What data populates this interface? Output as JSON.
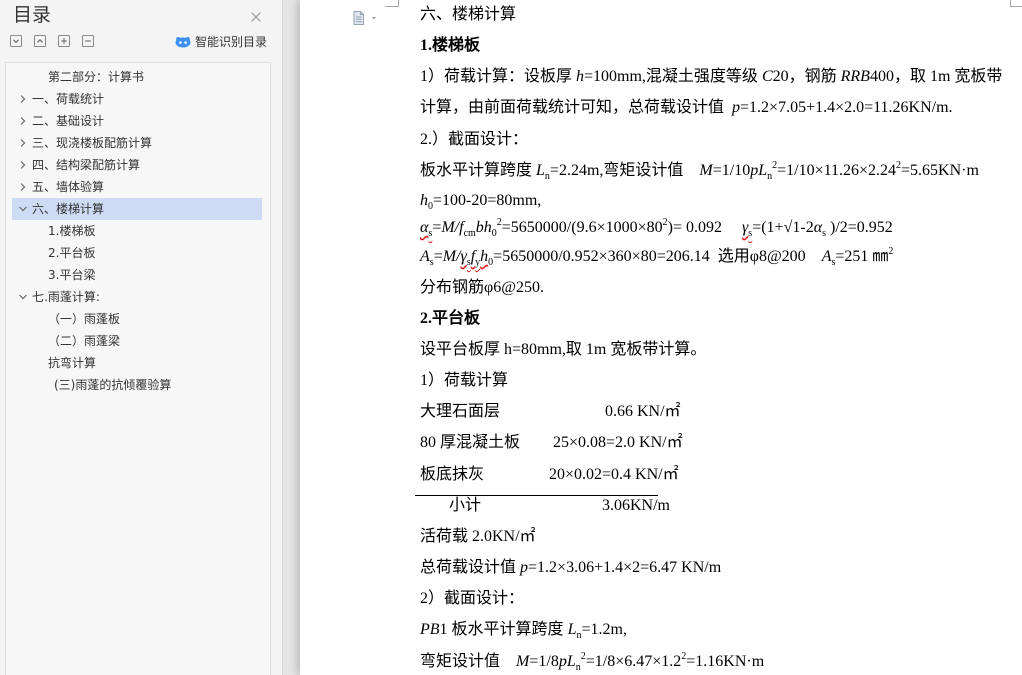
{
  "theme": {
    "selected_row": "#cddcf4",
    "accent": "#3a8ff5",
    "spellcheck_underline": "#e02020"
  },
  "sidebar": {
    "title": "目录",
    "close_icon": "close-icon",
    "tools": [
      "expand-all-icon",
      "collapse-all-icon",
      "add-heading-icon",
      "remove-heading-icon"
    ],
    "smart_toc": {
      "label": "智能识别目录",
      "icon": "smart-recognize-icon"
    },
    "items": [
      {
        "label": "第二部分：计算书",
        "level": 2,
        "icon": "",
        "selected": false
      },
      {
        "label": "一、荷载统计",
        "level": 1,
        "icon": "chevron-right-icon",
        "selected": false
      },
      {
        "label": "二、基础设计",
        "level": 1,
        "icon": "chevron-right-icon",
        "selected": false
      },
      {
        "label": "三、现浇楼板配筋计算",
        "level": 1,
        "icon": "chevron-right-icon",
        "selected": false
      },
      {
        "label": "四、结构梁配筋计算",
        "level": 1,
        "icon": "chevron-right-icon",
        "selected": false
      },
      {
        "label": "五、墙体验算",
        "level": 1,
        "icon": "chevron-right-icon",
        "selected": false
      },
      {
        "label": "六、楼梯计算",
        "level": 1,
        "icon": "chevron-down-icon",
        "selected": true
      },
      {
        "label": "1.楼梯板",
        "level": 2,
        "icon": "",
        "selected": false
      },
      {
        "label": "2.平台板",
        "level": 2,
        "icon": "",
        "selected": false
      },
      {
        "label": "3.平台梁",
        "level": 2,
        "icon": "",
        "selected": false
      },
      {
        "label": "七.雨蓬计算:",
        "level": 1,
        "icon": "chevron-down-icon",
        "selected": false
      },
      {
        "label": "（一）雨蓬板",
        "level": 2,
        "icon": "",
        "selected": false
      },
      {
        "label": "（二）雨蓬梁",
        "level": 2,
        "icon": "",
        "selected": false
      },
      {
        "label": "抗弯计算",
        "level": 2,
        "icon": "",
        "selected": false
      },
      {
        "label": "(三)雨蓬的抗倾覆验算",
        "level": 2,
        "icon": "",
        "selected": false
      }
    ]
  },
  "doc": {
    "menu_icon": "document-view-icon",
    "lines": [
      {
        "runs": [
          {
            "t": "六、楼梯计算"
          }
        ]
      },
      {
        "runs": [
          {
            "t": "1.楼梯板",
            "bold": true
          }
        ]
      },
      {
        "runs": [
          {
            "t": "1）荷载计算：设板厚 "
          },
          {
            "t": "h",
            "italic": true
          },
          {
            "t": "=100mm,混凝土强度等级 "
          },
          {
            "t": "C",
            "italic": true
          },
          {
            "t": "20，钢筋 "
          },
          {
            "t": "RRB",
            "italic": true
          },
          {
            "t": "400，取 1m 宽板带"
          }
        ]
      },
      {
        "runs": [
          {
            "t": "计算，由前面荷载统计可知，总荷载设计值  "
          },
          {
            "t": "p",
            "italic": true
          },
          {
            "t": "=1.2×7.05+1.4×2.0=11.26KN/m."
          }
        ]
      },
      {
        "runs": [
          {
            "t": "2.）截面设计："
          }
        ]
      },
      {
        "runs": [
          {
            "t": "板水平计算跨度 "
          },
          {
            "t": "L",
            "italic": true
          },
          {
            "t": "n",
            "sub": true
          },
          {
            "t": "=2.24m,弯矩设计值    "
          },
          {
            "t": "M",
            "italic": true
          },
          {
            "t": "=1/10"
          },
          {
            "t": "pL",
            "italic": true
          },
          {
            "t": "n",
            "sub": true
          },
          {
            "t": "2",
            "sup": true
          },
          {
            "t": "=1/10×11.26×2.24"
          },
          {
            "t": "2",
            "sup": true
          },
          {
            "t": "=5.65KN·m"
          }
        ]
      },
      {
        "runs": [
          {
            "t": "h",
            "italic": true
          },
          {
            "t": "0",
            "sub": true
          },
          {
            "t": "=100-20=80mm,"
          }
        ]
      },
      {
        "runs": [
          {
            "t": "α",
            "italic": true,
            "spellcheck": true
          },
          {
            "t": "s",
            "sub": true,
            "spellcheck": true
          },
          {
            "t": "="
          },
          {
            "t": "M/f",
            "italic": true
          },
          {
            "t": "cm",
            "sub": true
          },
          {
            "t": "bh",
            "italic": true
          },
          {
            "t": "0",
            "sub": true
          },
          {
            "t": "2",
            "sup": true
          },
          {
            "t": "=5650000/(9.6×1000×80"
          },
          {
            "t": "2",
            "sup": true
          },
          {
            "t": ")= 0.092     "
          },
          {
            "t": "γ",
            "italic": true,
            "spellcheck": true
          },
          {
            "t": "s",
            "sub": true,
            "spellcheck": true
          },
          {
            "t": "=(1+√1-2"
          },
          {
            "t": "α",
            "italic": true
          },
          {
            "t": "s",
            "sub": true
          },
          {
            "t": " )/2=0.952"
          }
        ]
      },
      {
        "runs": [
          {
            "t": "A",
            "italic": true
          },
          {
            "t": "s",
            "sub": true
          },
          {
            "t": "="
          },
          {
            "t": "M/",
            "italic": true
          },
          {
            "t": "γ",
            "italic": true,
            "spellcheck": true
          },
          {
            "t": "s",
            "sub": true,
            "spellcheck": true
          },
          {
            "t": "f",
            "italic": true,
            "spellcheck": true
          },
          {
            "t": "y",
            "sub": true,
            "spellcheck": true
          },
          {
            "t": "h",
            "italic": true,
            "spellcheck": true
          },
          {
            "t": "0",
            "sub": true
          },
          {
            "t": "=5650000/0.952×360×80=206.14  选用φ8@200    "
          },
          {
            "t": "A",
            "italic": true
          },
          {
            "t": "s",
            "sub": true
          },
          {
            "t": "=251 ㎜"
          },
          {
            "t": "2",
            "sup": true
          }
        ]
      },
      {
        "runs": [
          {
            "t": "分布钢筋φ6@250."
          }
        ]
      },
      {
        "runs": [
          {
            "t": "2.平台板",
            "bold": true
          }
        ]
      },
      {
        "runs": [
          {
            "t": "设平台板厚 h=80mm,取 1m 宽板带计算。"
          }
        ]
      },
      {
        "runs": [
          {
            "t": "1）荷载计算"
          }
        ]
      },
      {
        "runs": [
          {
            "t": "活荷载 2.0KN/㎡"
          }
        ]
      },
      {
        "runs": [
          {
            "t": "总荷载设计值 "
          },
          {
            "t": "p",
            "italic": true
          },
          {
            "t": "=1.2×3.06+1.4×2=6.47 KN/m"
          }
        ]
      },
      {
        "runs": [
          {
            "t": "2）截面设计："
          }
        ]
      },
      {
        "runs": [
          {
            "t": "PB",
            "italic": true
          },
          {
            "t": "1 板水平计算跨度 "
          },
          {
            "t": "L",
            "italic": true
          },
          {
            "t": "n",
            "sub": true
          },
          {
            "t": "=1.2m,"
          }
        ]
      },
      {
        "runs": [
          {
            "t": "弯矩设计值    "
          },
          {
            "t": "M",
            "italic": true
          },
          {
            "t": "=1/8"
          },
          {
            "t": "pL",
            "italic": true
          },
          {
            "t": "n",
            "sub": true
          },
          {
            "t": "2",
            "sup": true
          },
          {
            "t": "=1/8×6.47×1.2"
          },
          {
            "t": "2",
            "sup": true
          },
          {
            "t": "=1.16KN·m"
          }
        ]
      }
    ],
    "load_table": {
      "rows": [
        {
          "label": "大理石面层",
          "value": "0.66 KN/㎡"
        },
        {
          "label": "80 厚混凝土板",
          "value": "25×0.08=2.0 KN/㎡"
        },
        {
          "label": "板底抹灰",
          "value": "20×0.02=0.4 KN/㎡"
        }
      ],
      "total": {
        "label": "小计",
        "value": "3.06KN/m"
      }
    }
  }
}
